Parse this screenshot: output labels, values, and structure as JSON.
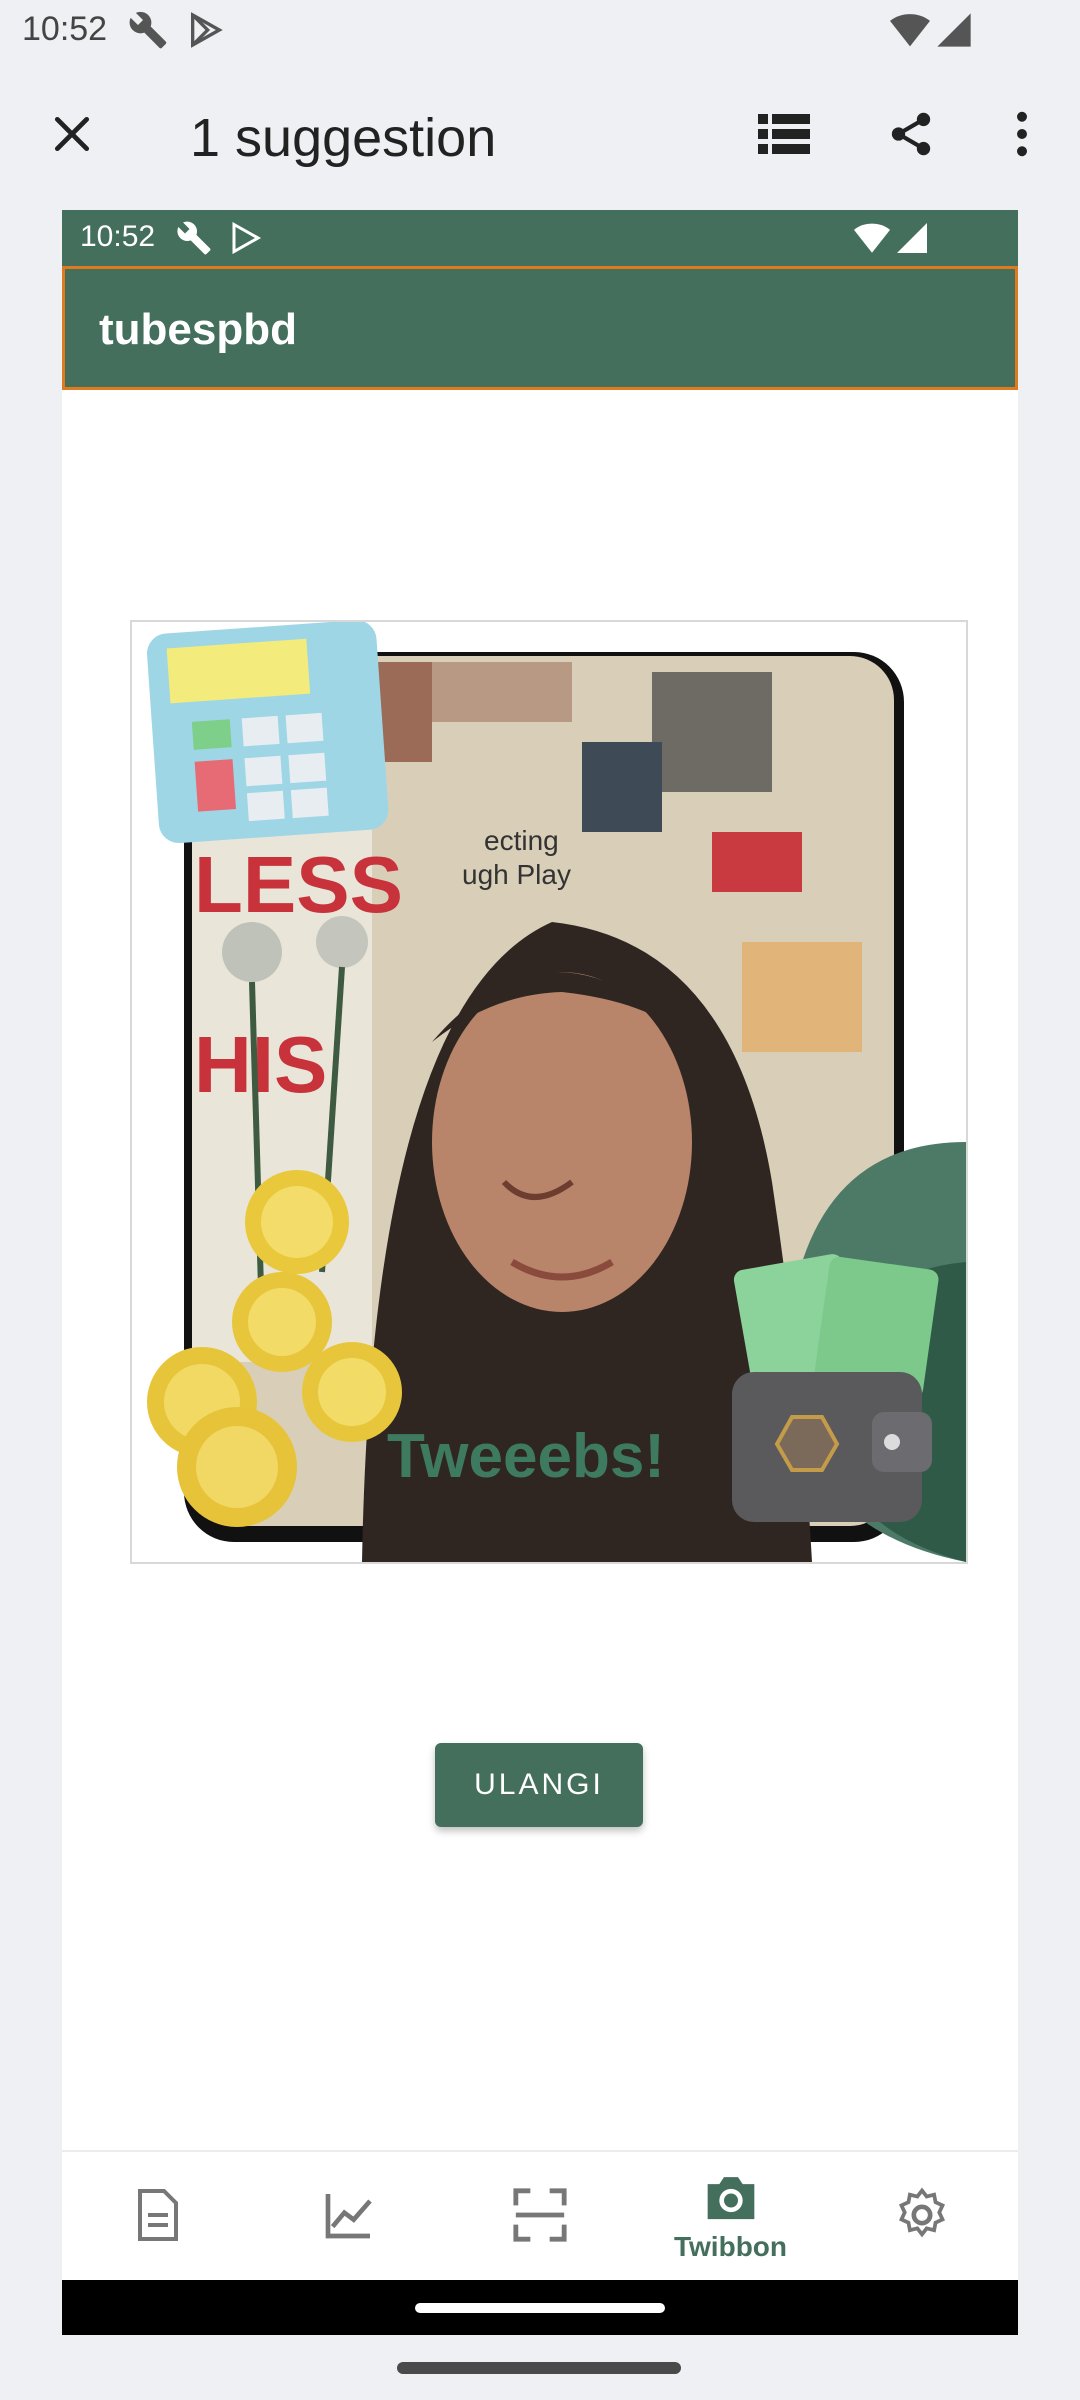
{
  "status_bar": {
    "time": "10:52",
    "icons": [
      "wrench-icon",
      "play-store-icon",
      "wifi-icon",
      "signal-icon"
    ]
  },
  "app_bar": {
    "title": "1 suggestion",
    "actions": [
      "close-icon",
      "list-icon",
      "share-icon",
      "more-vert-icon"
    ]
  },
  "inner_screen": {
    "status_bar": {
      "time": "10:52"
    },
    "app_title": "tubespbd",
    "twibbon": {
      "caption": "Tweeebs!",
      "photo_text": [
        "ecting",
        "ugh Play",
        "LESS",
        "HIS"
      ]
    },
    "retry_button": "ULANGI",
    "bottom_nav": {
      "items": [
        {
          "icon": "document-icon",
          "label": ""
        },
        {
          "icon": "chart-icon",
          "label": ""
        },
        {
          "icon": "scan-icon",
          "label": ""
        },
        {
          "icon": "camera-icon",
          "label": "Twibbon",
          "selected": true
        },
        {
          "icon": "settings-icon",
          "label": ""
        }
      ]
    }
  },
  "colors": {
    "primary": "#446f5d",
    "highlight": "#e07a1f",
    "background": "#eef0f3"
  }
}
